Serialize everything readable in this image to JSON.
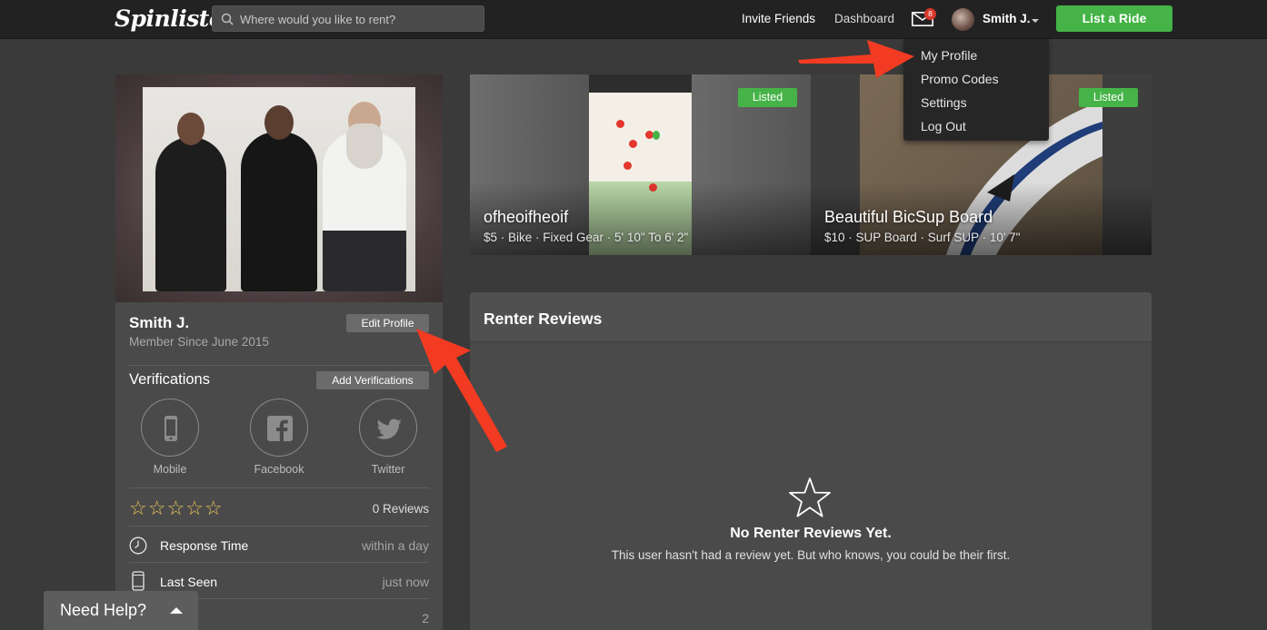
{
  "header": {
    "logo": "Spinlister",
    "search_placeholder": "Where would you like to rent?",
    "invite_friends": "Invite Friends",
    "dashboard": "Dashboard",
    "mail_badge": "8",
    "user_name": "Smith J.",
    "list_ride": "List a Ride"
  },
  "user_menu": {
    "items": [
      "My Profile",
      "Promo Codes",
      "Settings",
      "Log Out"
    ]
  },
  "profile": {
    "name": "Smith J.",
    "member_since": "Member Since June 2015",
    "edit_profile": "Edit Profile",
    "verifications_title": "Verifications",
    "add_verifications": "Add Verifications",
    "verifications": [
      {
        "label": "Mobile",
        "icon": "mobile-icon"
      },
      {
        "label": "Facebook",
        "icon": "facebook-icon"
      },
      {
        "label": "Twitter",
        "icon": "twitter-icon"
      }
    ],
    "rating_stars": "☆☆☆☆☆",
    "reviews_count": "0 Reviews",
    "stats": [
      {
        "label": "Response Time",
        "value": "within a day",
        "icon": "clock-icon"
      },
      {
        "label": "Last Seen",
        "value": "just now",
        "icon": "phone-icon"
      },
      {
        "label": "",
        "value": "2",
        "icon": ""
      }
    ]
  },
  "listings": [
    {
      "badge": "Listed",
      "title": "ofheoifheoif",
      "meta": "$5 · Bike · Fixed Gear · 5' 10\" To 6' 2\""
    },
    {
      "badge": "Listed",
      "title": "Beautiful BicSup Board",
      "meta": "$10 · SUP Board · Surf SUP · 10' 7\""
    }
  ],
  "reviews": {
    "title": "Renter Reviews",
    "empty_title": "No Renter Reviews Yet.",
    "empty_sub": "This user hasn't had a review yet. But who knows, you could be their first."
  },
  "help": {
    "label": "Need Help?"
  },
  "colors": {
    "background": "#3a3a3a",
    "topbar": "#222222",
    "accent_green": "#45b347",
    "annotation_red": "#f23b22",
    "star_gold": "#e8c15c"
  }
}
